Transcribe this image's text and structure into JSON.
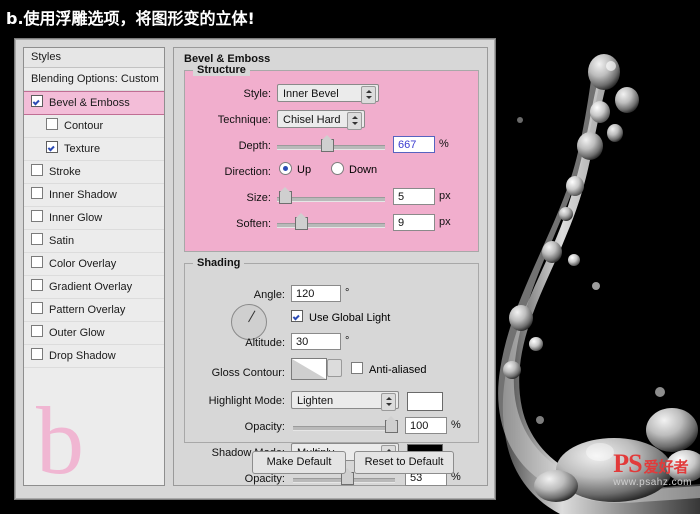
{
  "caption": "b.使用浮雕选项，将图形变的立体!",
  "dialog": {
    "styles_panel": {
      "header": "Styles",
      "items": [
        {
          "label": "Blending Options: Custom",
          "type": "plain",
          "checked": false,
          "selected": false,
          "indent": 0
        },
        {
          "label": "Bevel & Emboss",
          "type": "check",
          "checked": true,
          "selected": true,
          "indent": 0
        },
        {
          "label": "Contour",
          "type": "check",
          "checked": false,
          "selected": false,
          "indent": 1
        },
        {
          "label": "Texture",
          "type": "check",
          "checked": true,
          "selected": false,
          "indent": 1
        },
        {
          "label": "Stroke",
          "type": "check",
          "checked": false,
          "selected": false,
          "indent": 0
        },
        {
          "label": "Inner Shadow",
          "type": "check",
          "checked": false,
          "selected": false,
          "indent": 0
        },
        {
          "label": "Inner Glow",
          "type": "check",
          "checked": false,
          "selected": false,
          "indent": 0
        },
        {
          "label": "Satin",
          "type": "check",
          "checked": false,
          "selected": false,
          "indent": 0
        },
        {
          "label": "Color Overlay",
          "type": "check",
          "checked": false,
          "selected": false,
          "indent": 0
        },
        {
          "label": "Gradient Overlay",
          "type": "check",
          "checked": false,
          "selected": false,
          "indent": 0
        },
        {
          "label": "Pattern Overlay",
          "type": "check",
          "checked": false,
          "selected": false,
          "indent": 0
        },
        {
          "label": "Outer Glow",
          "type": "check",
          "checked": false,
          "selected": false,
          "indent": 0
        },
        {
          "label": "Drop Shadow",
          "type": "check",
          "checked": false,
          "selected": false,
          "indent": 0
        }
      ],
      "big_letter": "b"
    },
    "main": {
      "title": "Bevel & Emboss",
      "structure": {
        "legend": "Structure",
        "style_label": "Style:",
        "style_value": "Inner Bevel",
        "technique_label": "Technique:",
        "technique_value": "Chisel Hard",
        "depth_label": "Depth:",
        "depth_value": "667",
        "depth_unit": "%",
        "direction_label": "Direction:",
        "direction_up": "Up",
        "direction_down": "Down",
        "size_label": "Size:",
        "size_value": "5",
        "size_unit": "px",
        "soften_label": "Soften:",
        "soften_value": "9",
        "soften_unit": "px"
      },
      "shading": {
        "legend": "Shading",
        "angle_label": "Angle:",
        "angle_value": "120",
        "angle_unit": "°",
        "use_global_light": "Use Global Light",
        "altitude_label": "Altitude:",
        "altitude_value": "30",
        "altitude_unit": "°",
        "gloss_contour_label": "Gloss Contour:",
        "anti_aliased": "Anti-aliased",
        "highlight_mode_label": "Highlight Mode:",
        "highlight_mode_value": "Lighten",
        "highlight_color": "#ffffff",
        "highlight_opacity_label": "Opacity:",
        "highlight_opacity_value": "100",
        "highlight_opacity_unit": "%",
        "shadow_mode_label": "Shadow Mode:",
        "shadow_mode_value": "Multiply",
        "shadow_color": "#000000",
        "shadow_opacity_label": "Opacity:",
        "shadow_opacity_value": "53",
        "shadow_opacity_unit": "%"
      },
      "buttons": {
        "make_default": "Make Default",
        "reset_to_default": "Reset to Default"
      }
    }
  },
  "watermark": {
    "ps": "PS",
    "cn": "爱好者",
    "url": "www.psahz.com"
  },
  "colors": {
    "highlight_pink": "#f1aecd",
    "selection_pink": "#f3bdd8",
    "accent_blue": "#3b3bd0",
    "watermark_red": "#e23a3a"
  }
}
